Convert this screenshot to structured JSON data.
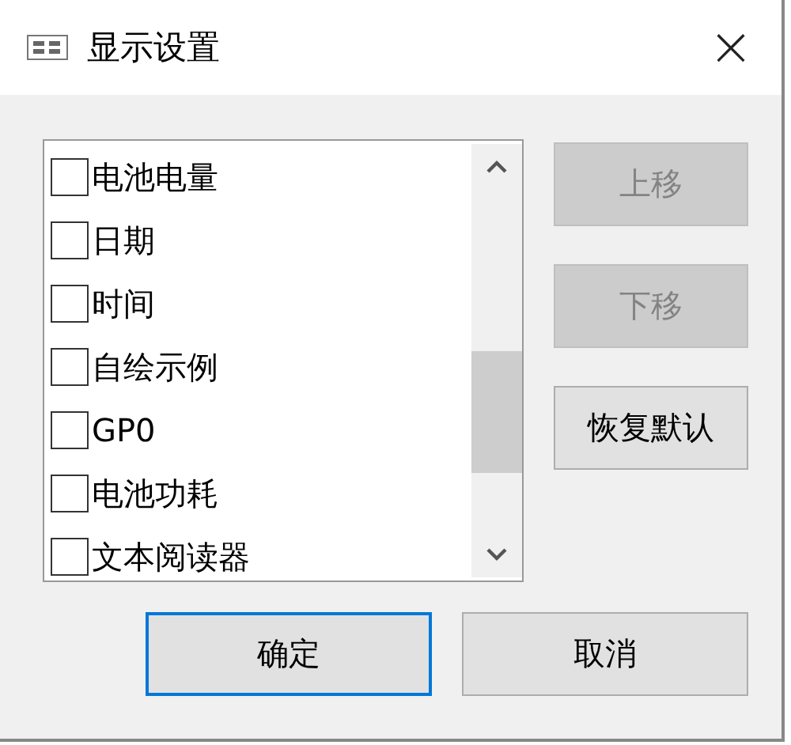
{
  "window": {
    "title": "显示设置",
    "close": "×"
  },
  "list": {
    "items": [
      {
        "label": "电池电量",
        "checked": false
      },
      {
        "label": "日期",
        "checked": false
      },
      {
        "label": "时间",
        "checked": false
      },
      {
        "label": "自绘示例",
        "checked": false
      },
      {
        "label": "GP0",
        "checked": false
      },
      {
        "label": "电池功耗",
        "checked": false
      },
      {
        "label": "文本阅读器",
        "checked": false
      }
    ]
  },
  "side_buttons": [
    {
      "label": "上移",
      "disabled": true
    },
    {
      "label": "下移",
      "disabled": true
    },
    {
      "label": "恢复默认",
      "disabled": false
    }
  ],
  "buttons": [
    {
      "label": "确定",
      "focused": true
    },
    {
      "label": "取消",
      "focused": false
    }
  ]
}
